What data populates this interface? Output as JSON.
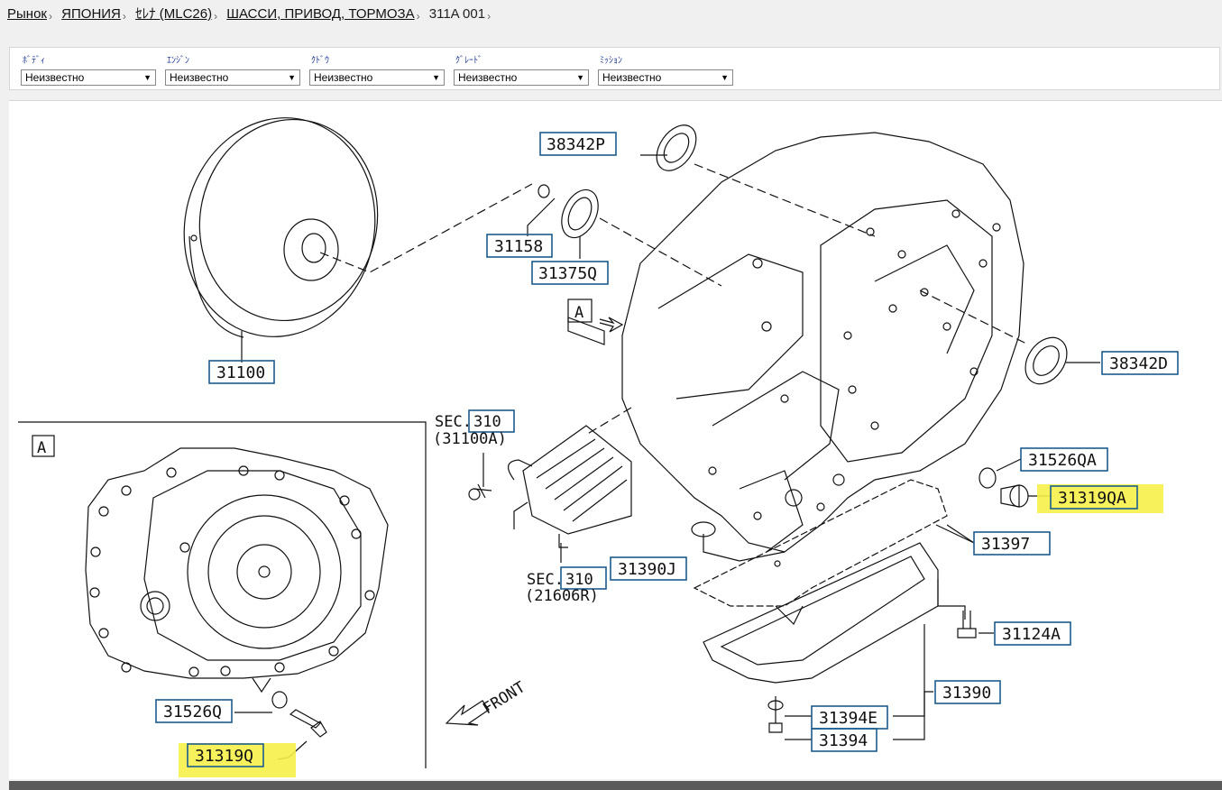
{
  "breadcrumb": {
    "items": [
      "Рынок",
      "ЯПОНИЯ",
      "ｾﾚﾅ (MLC26)",
      "ШАССИ, ПРИВОД, ТОРМОЗА"
    ],
    "current": "311A 001",
    "separator": "›"
  },
  "filters": [
    {
      "label": "ﾎﾞﾃﾞｨ",
      "value": "Неизвестно"
    },
    {
      "label": "ｴﾝｼﾞﾝ",
      "value": "Неизвестно"
    },
    {
      "label": "ｸﾄﾞｳ",
      "value": "Неизвестно"
    },
    {
      "label": "ｸﾞﾚｰﾄﾞ",
      "value": "Неизвестно"
    },
    {
      "label": "ﾐｯｼｮﾝ",
      "value": "Неизвестно"
    }
  ],
  "diagram": {
    "callouts": {
      "c38342P": "38342P",
      "c31158": "31158",
      "c31375Q": "31375Q",
      "c31100": "31100",
      "c38342D": "38342D",
      "c31526QA": "31526QA",
      "c31319QA": "31319QA",
      "c31397": "31397",
      "c31390J": "31390J",
      "c31124A": "31124A",
      "c31390": "31390",
      "c31394E": "31394E",
      "c31394": "31394",
      "c31526Q": "31526Q",
      "c31319Q": "31319Q"
    },
    "sec_refs": {
      "sec1_prefix": "SEC.",
      "sec1_num": "310",
      "sec1_sub": "(31100A)",
      "sec2_prefix": "SEC.",
      "sec2_num": "310",
      "sec2_sub": "(21606R)"
    },
    "view_label": "A",
    "inset_label": "A",
    "front_label": "FRONT"
  },
  "colors": {
    "link": "#111111",
    "callout_border": "#1b5c8e",
    "highlight": "#f6f14a",
    "filter_label": "#1f3a93"
  }
}
